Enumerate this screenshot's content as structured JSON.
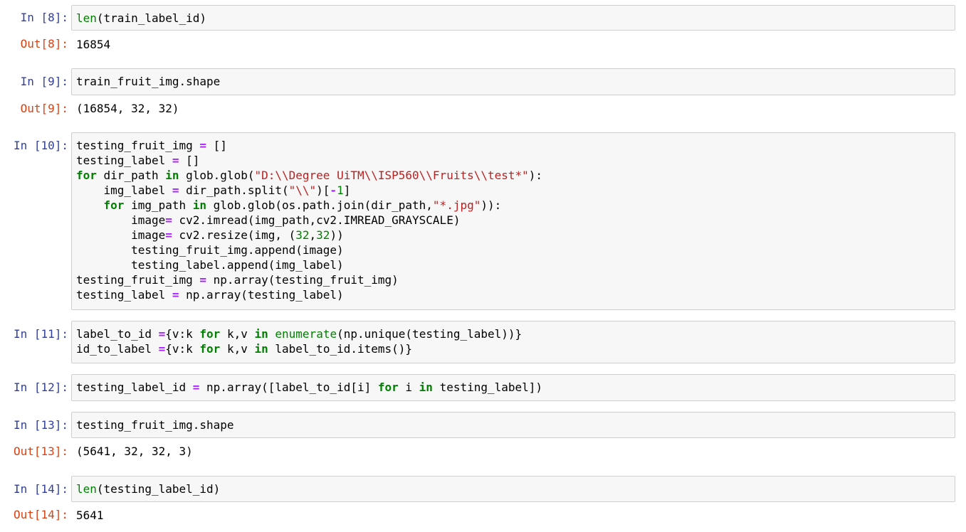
{
  "cells": [
    {
      "in_prompt": "In [8]:",
      "code": [
        [
          [
            "bi",
            "len"
          ],
          [
            "",
            "(train_label_id)"
          ]
        ]
      ],
      "out_prompt": "Out[8]:",
      "output": "16854"
    },
    {
      "in_prompt": "In [9]:",
      "code": [
        [
          [
            "",
            "train_fruit_img.shape"
          ]
        ]
      ],
      "out_prompt": "Out[9]:",
      "output": "(16854, 32, 32)"
    },
    {
      "in_prompt": "In [10]:",
      "code": [
        [
          [
            "",
            "testing_fruit_img "
          ],
          [
            "op",
            "="
          ],
          [
            "",
            " []"
          ]
        ],
        [
          [
            "",
            "testing_label "
          ],
          [
            "op",
            "="
          ],
          [
            "",
            " []"
          ]
        ],
        [
          [
            "kw",
            "for"
          ],
          [
            "",
            " dir_path "
          ],
          [
            "kw",
            "in"
          ],
          [
            "",
            " glob.glob("
          ],
          [
            "str",
            "\"D:\\\\Degree UiTM\\\\ISP560\\\\Fruits\\\\test*\""
          ],
          [
            "",
            "):"
          ]
        ],
        [
          [
            "",
            "    img_label "
          ],
          [
            "op",
            "="
          ],
          [
            "",
            " dir_path.split("
          ],
          [
            "str",
            "\"\\\\\""
          ],
          [
            "",
            ")["
          ],
          [
            "op",
            "-"
          ],
          [
            "num",
            "1"
          ],
          [
            "",
            "]"
          ]
        ],
        [
          [
            "",
            "    "
          ],
          [
            "kw",
            "for"
          ],
          [
            "",
            " img_path "
          ],
          [
            "kw",
            "in"
          ],
          [
            "",
            " glob.glob(os.path.join(dir_path,"
          ],
          [
            "str",
            "\"*.jpg\""
          ],
          [
            "",
            "))"
          ],
          [
            "",
            ":"
          ]
        ],
        [
          [
            "",
            "        image"
          ],
          [
            "op",
            "="
          ],
          [
            "",
            " cv2.imread(img_path,cv2.IMREAD_GRAYSCALE)"
          ]
        ],
        [
          [
            "",
            "        image"
          ],
          [
            "op",
            "="
          ],
          [
            "",
            " cv2.resize(img, ("
          ],
          [
            "num",
            "32"
          ],
          [
            "",
            ","
          ],
          [
            "num",
            "32"
          ],
          [
            "",
            "))"
          ]
        ],
        [
          [
            "",
            "        testing_fruit_img.append(image)"
          ]
        ],
        [
          [
            "",
            "        testing_label.append(img_label)"
          ]
        ],
        [
          [
            "",
            "testing_fruit_img "
          ],
          [
            "op",
            "="
          ],
          [
            "",
            " np.array(testing_fruit_img)"
          ]
        ],
        [
          [
            "",
            "testing_label "
          ],
          [
            "op",
            "="
          ],
          [
            "",
            " np.array(testing_label)"
          ]
        ]
      ]
    },
    {
      "in_prompt": "In [11]:",
      "code": [
        [
          [
            "",
            "label_to_id "
          ],
          [
            "op",
            "="
          ],
          [
            "",
            "{v:k "
          ],
          [
            "kw",
            "for"
          ],
          [
            "",
            " k,v "
          ],
          [
            "kw",
            "in"
          ],
          [
            "",
            " "
          ],
          [
            "bi",
            "enumerate"
          ],
          [
            "",
            "(np.unique(testing_label))}"
          ]
        ],
        [
          [
            "",
            "id_to_label "
          ],
          [
            "op",
            "="
          ],
          [
            "",
            "{v:k "
          ],
          [
            "kw",
            "for"
          ],
          [
            "",
            " k,v "
          ],
          [
            "kw",
            "in"
          ],
          [
            "",
            " label_to_id.items()}"
          ]
        ]
      ]
    },
    {
      "in_prompt": "In [12]:",
      "code": [
        [
          [
            "",
            "testing_label_id "
          ],
          [
            "op",
            "="
          ],
          [
            "",
            " np.array([label_to_id[i] "
          ],
          [
            "kw",
            "for"
          ],
          [
            "",
            " i "
          ],
          [
            "kw",
            "in"
          ],
          [
            "",
            " testing_label])"
          ]
        ]
      ]
    },
    {
      "in_prompt": "In [13]:",
      "code": [
        [
          [
            "",
            "testing_fruit_img.shape"
          ]
        ]
      ],
      "out_prompt": "Out[13]:",
      "output": "(5641, 32, 32, 3)"
    },
    {
      "in_prompt": "In [14]:",
      "code": [
        [
          [
            "bi",
            "len"
          ],
          [
            "",
            "(testing_label_id)"
          ]
        ]
      ],
      "out_prompt": "Out[14]:",
      "output": "5641"
    }
  ]
}
